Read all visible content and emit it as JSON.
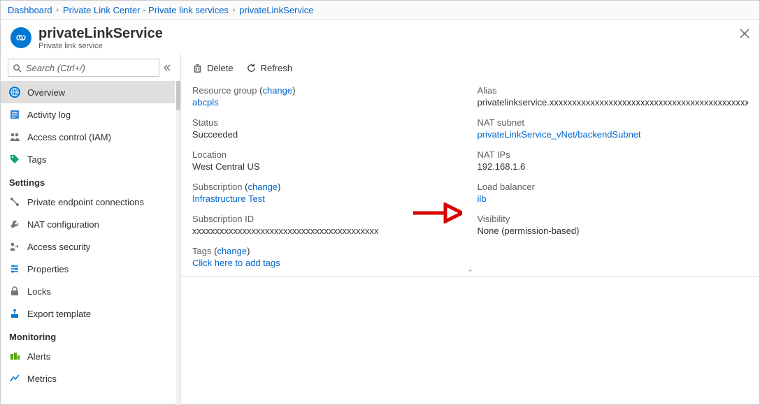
{
  "breadcrumb": [
    "Dashboard",
    "Private Link Center - Private link services",
    "privateLinkService"
  ],
  "header": {
    "title": "privateLinkService",
    "subtitle": "Private link service"
  },
  "search": {
    "placeholder": "Search (Ctrl+/)"
  },
  "nav": {
    "top": [
      {
        "id": "overview",
        "label": "Overview",
        "selected": true,
        "icon": "globe-icon"
      },
      {
        "id": "activity",
        "label": "Activity log",
        "icon": "log-icon"
      },
      {
        "id": "iam",
        "label": "Access control (IAM)",
        "icon": "people-icon"
      },
      {
        "id": "tags",
        "label": "Tags",
        "icon": "tag-icon"
      }
    ],
    "settings_header": "Settings",
    "settings": [
      {
        "id": "pec",
        "label": "Private endpoint connections",
        "icon": "connections-icon"
      },
      {
        "id": "nat",
        "label": "NAT configuration",
        "icon": "wrench-icon"
      },
      {
        "id": "accsec",
        "label": "Access security",
        "icon": "people-arrow-icon"
      },
      {
        "id": "props",
        "label": "Properties",
        "icon": "sliders-icon"
      },
      {
        "id": "locks",
        "label": "Locks",
        "icon": "lock-icon"
      },
      {
        "id": "export",
        "label": "Export template",
        "icon": "export-icon"
      }
    ],
    "monitoring_header": "Monitoring",
    "monitoring": [
      {
        "id": "alerts",
        "label": "Alerts",
        "icon": "alert-icon"
      },
      {
        "id": "metrics",
        "label": "Metrics",
        "icon": "metrics-icon"
      }
    ]
  },
  "toolbar": {
    "delete": "Delete",
    "refresh": "Refresh"
  },
  "left_fields": {
    "rg": {
      "label": "Resource group",
      "change": "change",
      "value": "abcpls"
    },
    "status": {
      "label": "Status",
      "value": "Succeeded"
    },
    "loc": {
      "label": "Location",
      "value": "West Central US"
    },
    "sub": {
      "label": "Subscription",
      "change": "change",
      "value": "Infrastructure Test"
    },
    "subid": {
      "label": "Subscription ID",
      "value": "xxxxxxxxxxxxxxxxxxxxxxxxxxxxxxxxxxxxxxxxx"
    },
    "tags": {
      "label": "Tags",
      "change": "change",
      "value": "Click here to add tags"
    }
  },
  "right_fields": {
    "alias": {
      "label": "Alias",
      "value": "privatelinkservice.xxxxxxxxxxxxxxxxxxxxxxxxxxxxxxxxxxxxxxxxxxxxxxxxx"
    },
    "natsub": {
      "label": "NAT subnet",
      "value": "privateLinkService_vNet/backendSubnet"
    },
    "natips": {
      "label": "NAT IPs",
      "value": "192.168.1.6"
    },
    "lb": {
      "label": "Load balancer",
      "value": "ilb"
    },
    "vis": {
      "label": "Visibility",
      "value": "None (permission-based)"
    }
  }
}
